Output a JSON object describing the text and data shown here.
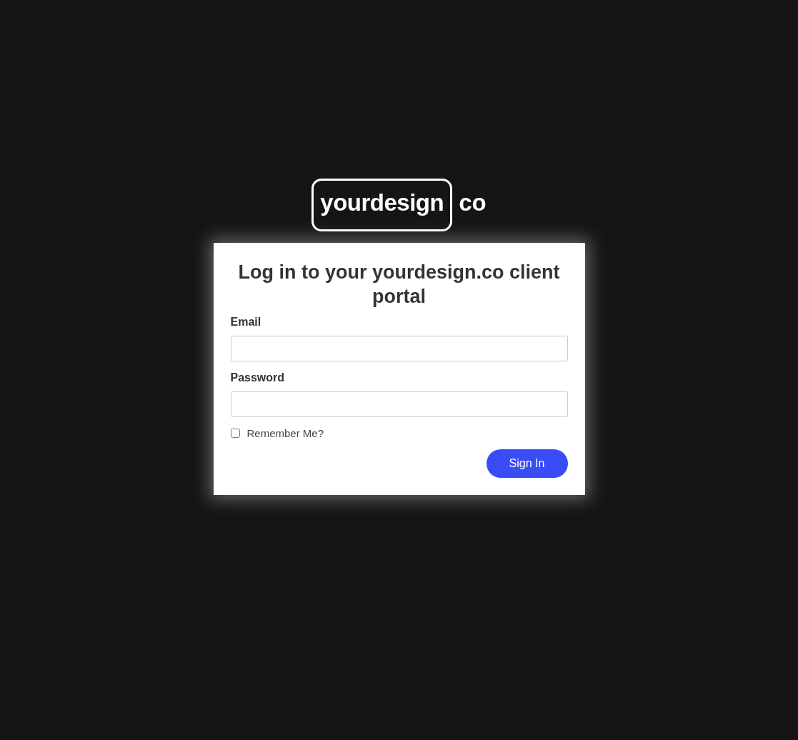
{
  "logo": {
    "boxed_text": "yourdesign",
    "suffix": "co"
  },
  "login": {
    "title": "Log in to your yourdesign.co client portal",
    "fields": [
      {
        "label": "Email"
      },
      {
        "label": "Password"
      }
    ],
    "remember": {
      "label": "Remember Me?",
      "checked": false
    },
    "button": "Sign In"
  }
}
